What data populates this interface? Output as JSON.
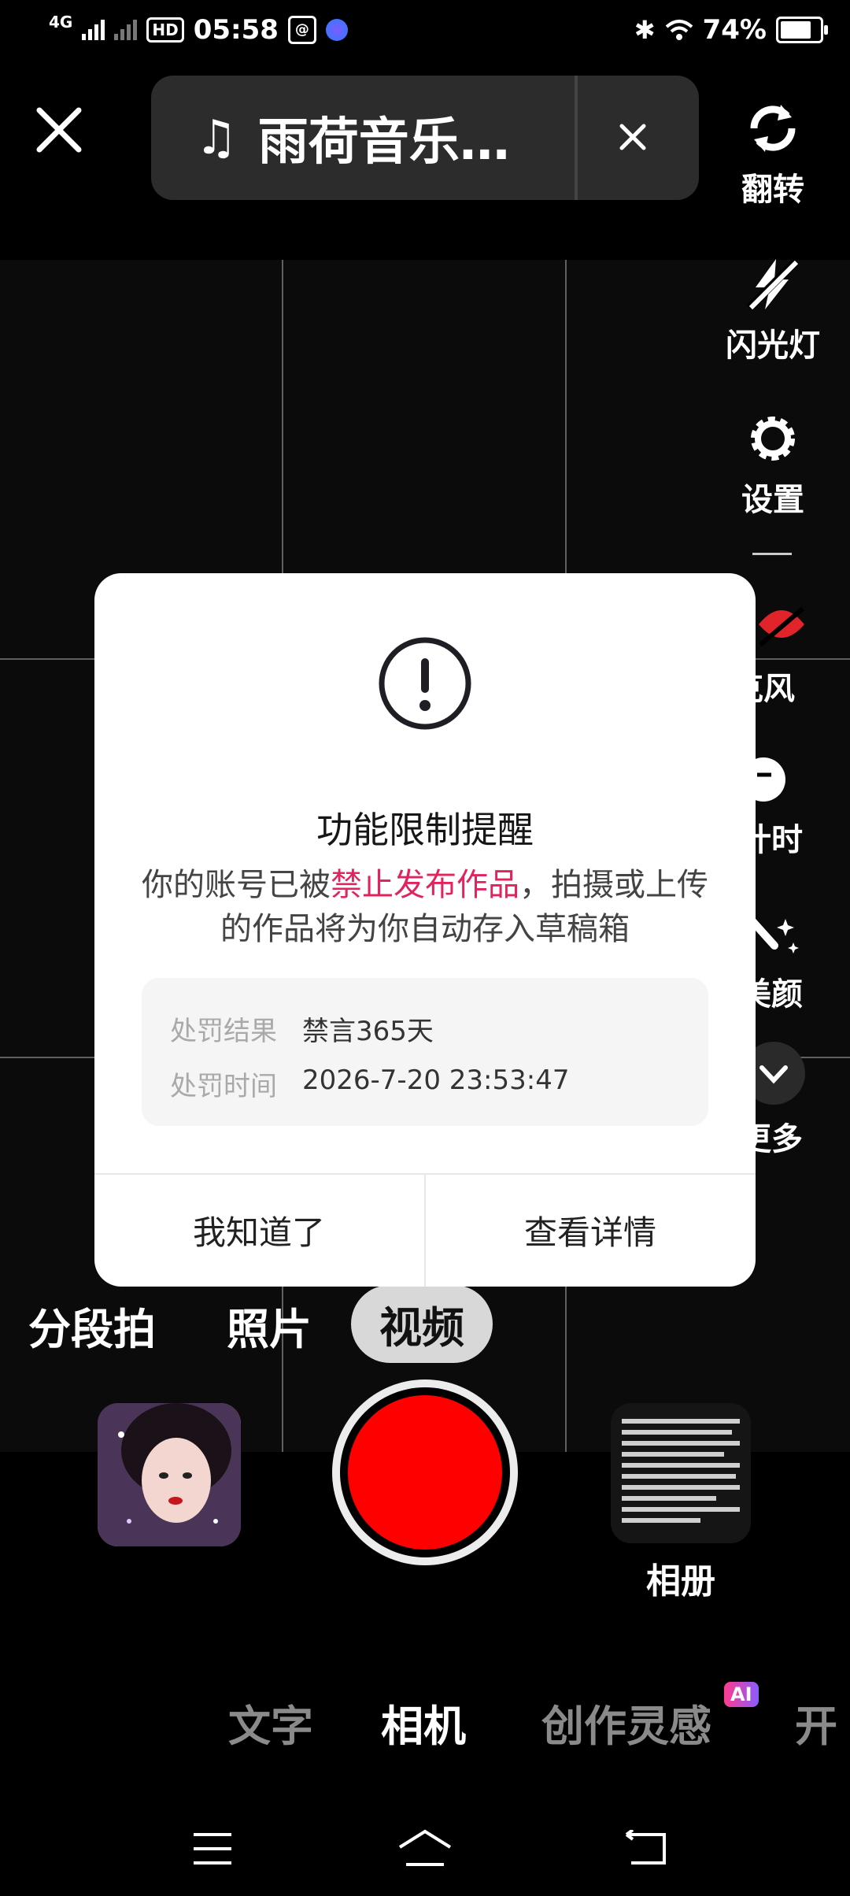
{
  "status_bar": {
    "network": "4G",
    "hd_label": "HD",
    "time": "05:58",
    "battery": "74%"
  },
  "top_bar": {
    "music_title": "雨荷音乐…"
  },
  "right_tools": {
    "flip": "翻转",
    "flash": "闪光灯",
    "settings": "设置",
    "mic": "克风",
    "timer": "计时",
    "beauty": "美颜",
    "more": "更多"
  },
  "modes": {
    "segment": "分段拍",
    "photo": "照片",
    "video": "视频"
  },
  "album_label": "相册",
  "bottom_tabs": {
    "text": "文字",
    "camera": "相机",
    "inspiration": "创作灵感",
    "ai_badge": "AI",
    "live": "开"
  },
  "dialog": {
    "title": "功能限制提醒",
    "msg_before": "你的账号已被",
    "msg_highlight": "禁止发布作品",
    "msg_after": "，拍摄或上传的作品将为你自动存入草稿箱",
    "penalty_result_label": "处罚结果",
    "penalty_result_value": "禁言365天",
    "penalty_time_label": "处罚时间",
    "penalty_time_value": "2026-7-20 23:53:47",
    "ok_button": "我知道了",
    "details_button": "查看详情"
  },
  "colors": {
    "highlight": "#e0245e",
    "record": "#ff0000"
  }
}
